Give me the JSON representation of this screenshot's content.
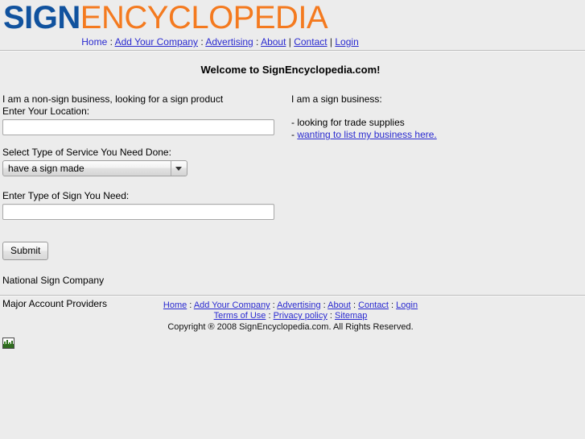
{
  "header": {
    "logo": {
      "part1": "SIGN",
      "part2": "ENCYCLOPEDIA",
      "color1": "#10529e",
      "color2": "#f47a1f"
    },
    "nav": {
      "items": [
        {
          "label": "Home",
          "underlined": false
        },
        {
          "label": "Add Your Company",
          "underlined": true
        },
        {
          "label": "Advertising",
          "underlined": true
        },
        {
          "label": "About",
          "underlined": true
        },
        {
          "label": "Contact",
          "underlined": true
        },
        {
          "label": "Login",
          "underlined": true
        }
      ],
      "sep_colon": " : ",
      "sep_pipe": " | "
    }
  },
  "main": {
    "welcome_title": "Welcome to SignEncyclopedia.com!",
    "left": {
      "intro": "I am a non-sign business, looking for a sign product",
      "location_label": "Enter Your Location:",
      "location_value": "",
      "location_placeholder": "",
      "service_label": "Select Type of Service You Need Done:",
      "service_selected": "have a sign made",
      "sign_type_label": "Enter Type of Sign You Need:",
      "sign_type_value": "",
      "sign_type_placeholder": "",
      "submit_label": "Submit",
      "national_sign_company": "National Sign Company",
      "major_account_providers": "Major Account Providers"
    },
    "right": {
      "intro": "I am a sign business:",
      "bullet1": "- looking for trade supplies",
      "bullet2_dash": "- ",
      "bullet2_link": "wanting to list my business here."
    }
  },
  "footer": {
    "nav": [
      "Home",
      "Add Your Company",
      "Advertising",
      "About",
      "Contact",
      "Login"
    ],
    "legal": [
      "Terms of Use",
      "Privacy policy",
      "Sitemap"
    ],
    "sep": " : ",
    "copyright": "Copyright ® 2008 SignEncyclopedia.com. All Rights Reserved."
  },
  "bottom_icon": {
    "name": "chart-image-icon"
  }
}
